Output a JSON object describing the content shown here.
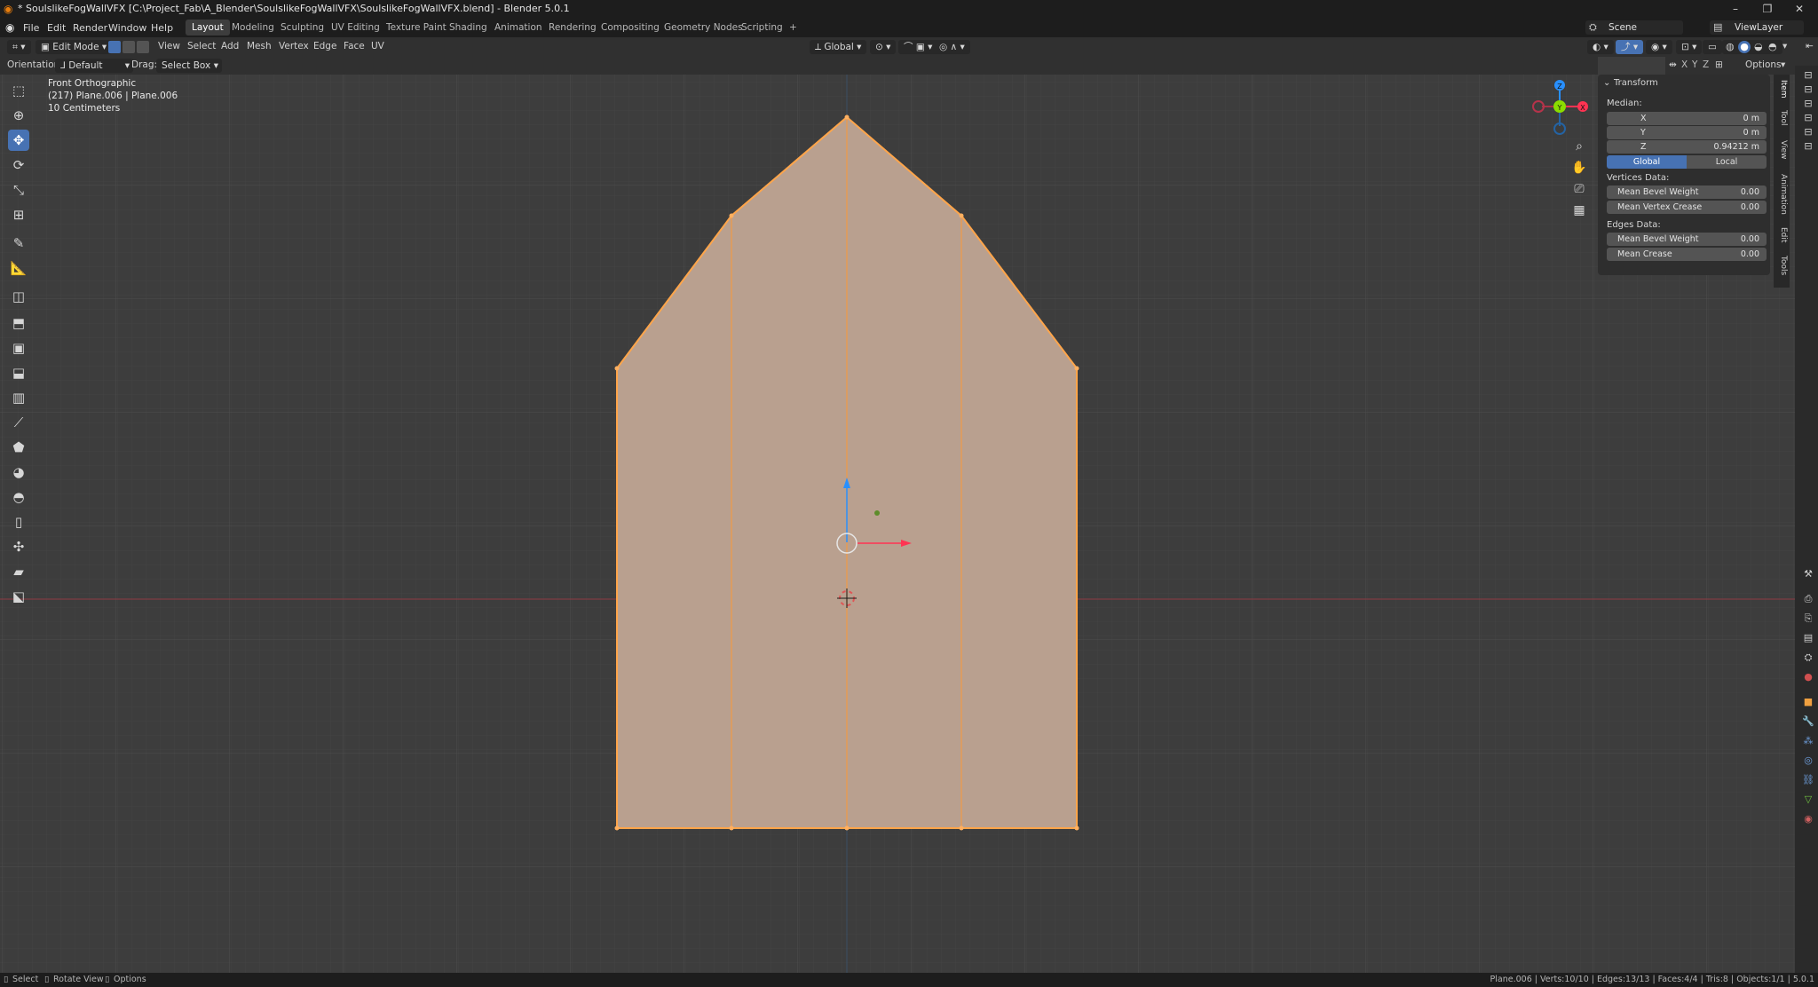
{
  "window": {
    "title": "* SoulslikeFogWallVFX [C:\\Project_Fab\\A_Blender\\SoulslikeFogWallVFX\\SoulslikeFogWallVFX.blend] - Blender 5.0.1",
    "minimize": "–",
    "maximize": "❐",
    "close": "✕"
  },
  "menubar": {
    "items": [
      "File",
      "Edit",
      "Render",
      "Window",
      "Help"
    ],
    "workspaces": [
      "Layout",
      "Modeling",
      "Sculpting",
      "UV Editing",
      "Texture Paint",
      "Shading",
      "Animation",
      "Rendering",
      "Compositing",
      "Geometry Nodes",
      "Scripting"
    ],
    "add_workspace": "+",
    "scene": "Scene",
    "view_layer": "ViewLayer"
  },
  "header": {
    "mode": "Edit Mode",
    "menus": [
      "View",
      "Select",
      "Add",
      "Mesh",
      "Vertex",
      "Edge",
      "Face",
      "UV"
    ],
    "transform_orientation": "Global",
    "options": "Options"
  },
  "tool_header": {
    "orientation_label": "Orientation:",
    "orientation_value": "Default",
    "drag_label": "Drag:",
    "drag_value": "Select Box",
    "axes": [
      "X",
      "Y",
      "Z"
    ]
  },
  "viewport": {
    "view_name": "Front Orthographic",
    "object_info": "(217) Plane.006 | Plane.006",
    "grid_scale": "10 Centimeters",
    "gizmo_labels": [
      "Z",
      "Y",
      "X"
    ]
  },
  "npanel": {
    "section": "Transform",
    "median_label": "Median:",
    "median": [
      {
        "key": "X",
        "value": "0 m"
      },
      {
        "key": "Y",
        "value": "0 m"
      },
      {
        "key": "Z",
        "value": "0.94212 m"
      }
    ],
    "space_global": "Global",
    "space_local": "Local",
    "vertices_label": "Vertices Data:",
    "vertices": [
      {
        "key": "Mean Bevel Weight",
        "value": "0.00"
      },
      {
        "key": "Mean Vertex Crease",
        "value": "0.00"
      }
    ],
    "edges_label": "Edges Data:",
    "edges": [
      {
        "key": "Mean Bevel Weight",
        "value": "0.00"
      },
      {
        "key": "Mean Crease",
        "value": "0.00"
      }
    ],
    "tabs": [
      "Item",
      "Tool",
      "View",
      "Animation",
      "Edit",
      "Tools"
    ]
  },
  "statusbar": {
    "left": [
      "Select",
      "Rotate View",
      "Options"
    ],
    "right": "Plane.006 | Verts:10/10 | Edges:13/13 | Faces:4/4 | Tris:8 | Objects:1/1 | 5.0.1"
  },
  "colors": {
    "face_fill": "#b9a08f",
    "edge_selected": "#ffa54a",
    "active_blue": "#4772b3",
    "x_axis": "#ff3352",
    "y_axis": "#8bdc00",
    "z_axis": "#2890ff"
  }
}
